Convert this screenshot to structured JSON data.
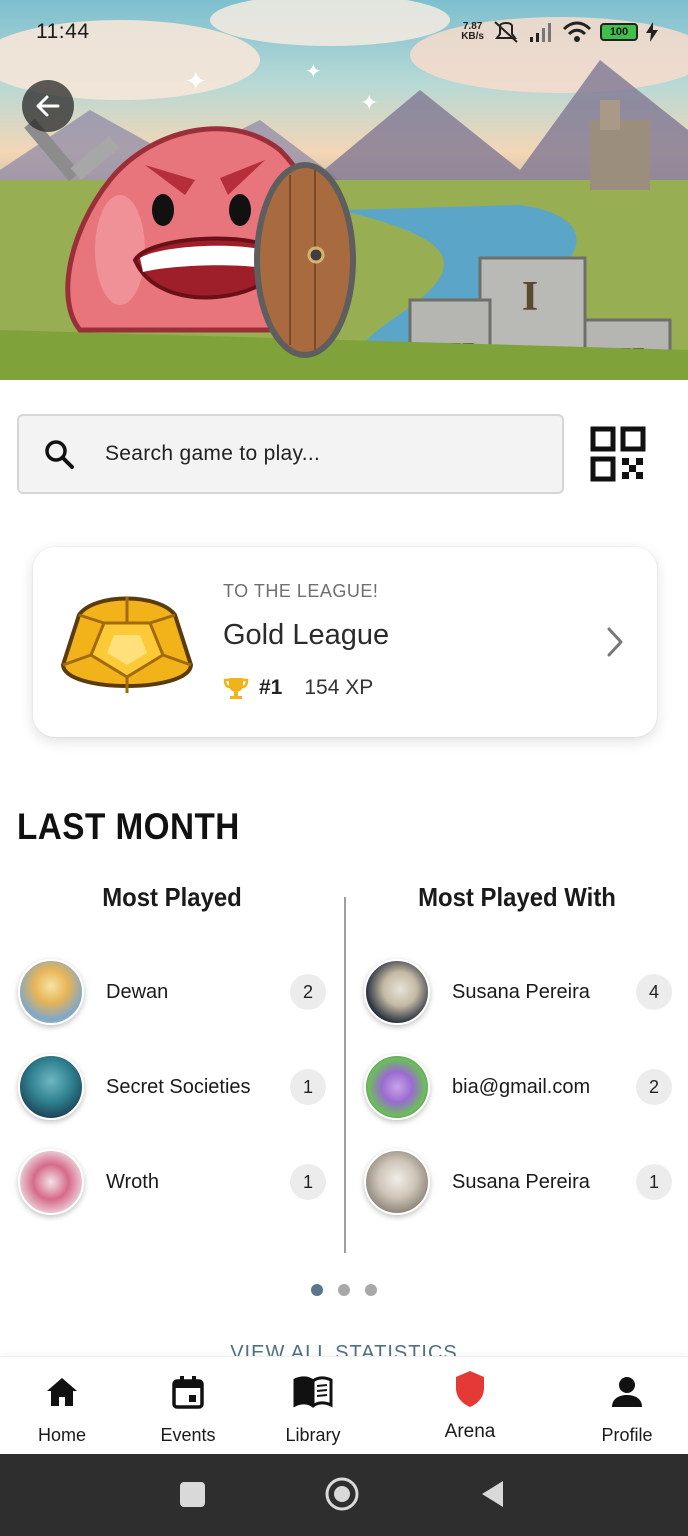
{
  "status_bar": {
    "time": "11:44",
    "net_speed_value": "7.87",
    "net_speed_unit": "KB/s",
    "battery": "100",
    "icons": [
      "mute-icon",
      "signal-icon",
      "wifi-icon",
      "battery-icon",
      "charging-icon"
    ]
  },
  "hero": {
    "back_icon": "arrow-left-icon"
  },
  "search": {
    "placeholder": "Search game to play..."
  },
  "league": {
    "eyebrow": "TO THE LEAGUE!",
    "name": "Gold League",
    "rank": "#1",
    "xp": "154 XP",
    "accent": "#f2b31a"
  },
  "last_month": {
    "title": "LAST MONTH",
    "most_played": {
      "title": "Most Played",
      "items": [
        {
          "label": "Dewan",
          "count": "2"
        },
        {
          "label": "Secret Societies",
          "count": "1"
        },
        {
          "label": "Wroth",
          "count": "1"
        }
      ]
    },
    "most_played_with": {
      "title": "Most Played With",
      "items": [
        {
          "label": "Susana Pereira",
          "count": "4"
        },
        {
          "label": "bia@gmail.com",
          "count": "2"
        },
        {
          "label": "Susana Pereira",
          "count": "1"
        }
      ]
    },
    "pager": {
      "pages": 3,
      "active": 1
    },
    "view_all": "VIEW ALL STATISTICS"
  },
  "nav": {
    "items": [
      {
        "label": "Home",
        "icon": "home-icon"
      },
      {
        "label": "Events",
        "icon": "calendar-icon"
      },
      {
        "label": "Library",
        "icon": "book-icon"
      },
      {
        "label": "Arena",
        "icon": "shield-icon",
        "color": "#e53935"
      },
      {
        "label": "Profile",
        "icon": "person-icon"
      }
    ]
  }
}
